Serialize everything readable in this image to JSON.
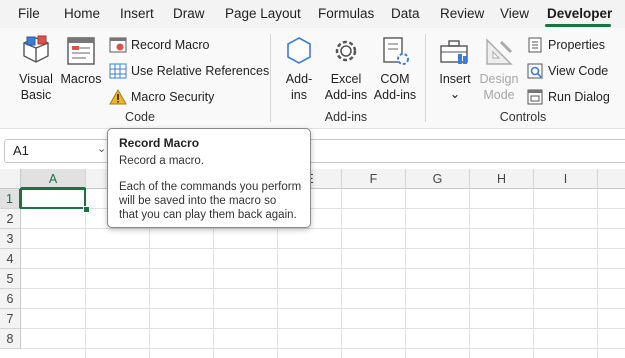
{
  "menu": {
    "tabs": [
      "File",
      "Home",
      "Insert",
      "Draw",
      "Page Layout",
      "Formulas",
      "Data",
      "Review",
      "View",
      "Developer"
    ],
    "active": "Developer"
  },
  "ribbon": {
    "code": {
      "label": "Code",
      "visual_basic": "Visual Basic",
      "visual_basic_l1": "Visual",
      "visual_basic_l2": "Basic",
      "macros": "Macros",
      "record_macro": "Record Macro",
      "use_relative": "Use Relative References",
      "macro_security": "Macro Security"
    },
    "addins": {
      "label": "Add-ins",
      "addins_l1": "Add-",
      "addins_l2": "ins",
      "excel_l1": "Excel",
      "excel_l2": "Add-ins",
      "com_l1": "COM",
      "com_l2": "Add-ins"
    },
    "controls": {
      "label": "Controls",
      "insert": "Insert",
      "design_l1": "Design",
      "design_l2": "Mode",
      "properties": "Properties",
      "view_code": "View Code",
      "run_dialog": "Run Dialog"
    }
  },
  "namebox": {
    "value": "A1"
  },
  "grid": {
    "columns": [
      "A",
      "B",
      "C",
      "D",
      "E",
      "F",
      "G",
      "H",
      "I"
    ],
    "rows": [
      "1",
      "2",
      "3",
      "4",
      "5",
      "6",
      "7",
      "8"
    ],
    "selected": "A1"
  },
  "tooltip": {
    "title": "Record Macro",
    "subtitle": "Record a macro.",
    "body_lines": [
      "Each of the commands you perform",
      "will be saved into the macro so",
      "that you can play them back again."
    ]
  },
  "colors": {
    "accent": "#1e7145",
    "ribbon_bg": "#f9f9f9",
    "menu_bg": "#f3f3f3"
  }
}
